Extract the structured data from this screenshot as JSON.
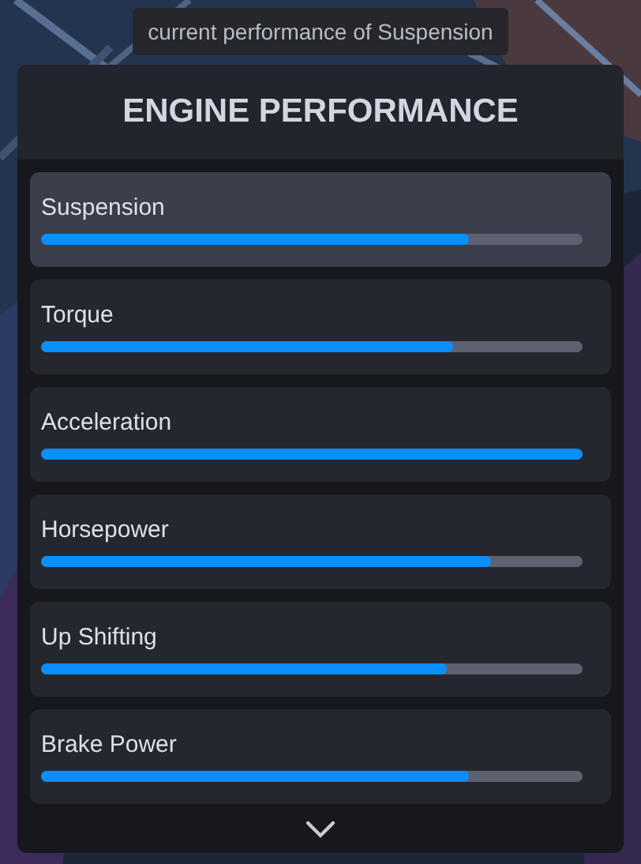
{
  "tooltip": "current performance of Suspension",
  "panel": {
    "title": "ENGINE PERFORMANCE",
    "items": [
      {
        "label": "Suspension",
        "level": 0.79,
        "selected": true
      },
      {
        "label": "Torque",
        "level": 0.76,
        "selected": false
      },
      {
        "label": "Acceleration",
        "level": 1.0,
        "selected": false
      },
      {
        "label": "Horsepower",
        "level": 0.83,
        "selected": false
      },
      {
        "label": "Up Shifting",
        "level": 0.75,
        "selected": false
      },
      {
        "label": "Brake Power",
        "level": 0.79,
        "selected": false
      }
    ]
  }
}
